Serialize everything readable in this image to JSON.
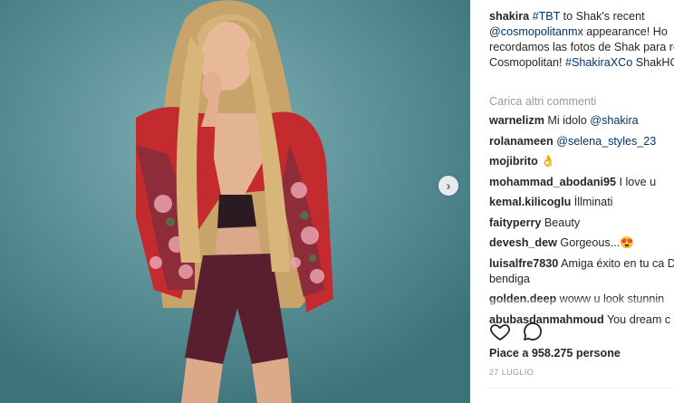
{
  "post": {
    "image_alt": "Photo of a woman with long blonde hair wearing a red floral bomber jacket and burgundy shorts",
    "next_icon": "chevron-right-icon",
    "caption": {
      "username": "shakira",
      "hashtag1": "#TBT",
      "text1": " to Shak's recent ",
      "mention": "@cosmopolitanmx",
      "text2": " appearance! Ho recordamos las fotos de Shak para revista Cosmopolitan! ",
      "hashtag2": "#ShakiraXCo",
      "text3": " ShakHQ"
    },
    "load_more": "Carica altri commenti",
    "comments": [
      {
        "user": "warnelizm",
        "text": "Mi idolo ",
        "mention": "@shakira"
      },
      {
        "user": "rolanameen",
        "text": "",
        "mention": "@selena_styles_23"
      },
      {
        "user": "mojibrito",
        "text": "👌"
      },
      {
        "user": "mohammad_abodani95",
        "text": "I love u"
      },
      {
        "user": "kemal.kilicoglu",
        "text": "İllminati"
      },
      {
        "user": "faityperry",
        "text": "Beauty"
      },
      {
        "user": "devesh_dew",
        "text": "Gorgeous...😍"
      },
      {
        "user": "luisalfre7830",
        "text": "Amiga éxito en tu ca Dios te bendiga"
      },
      {
        "user": "golden.deep",
        "text": "woww u look stunnin"
      },
      {
        "user": "abubasdanmahmoud",
        "text": "You dream c"
      }
    ],
    "actions": {
      "like_icon": "heart-outline-icon",
      "comment_icon": "comment-bubble-icon"
    },
    "likes": "Piace a 958.275 persone",
    "date": "27 LUGLIO"
  }
}
